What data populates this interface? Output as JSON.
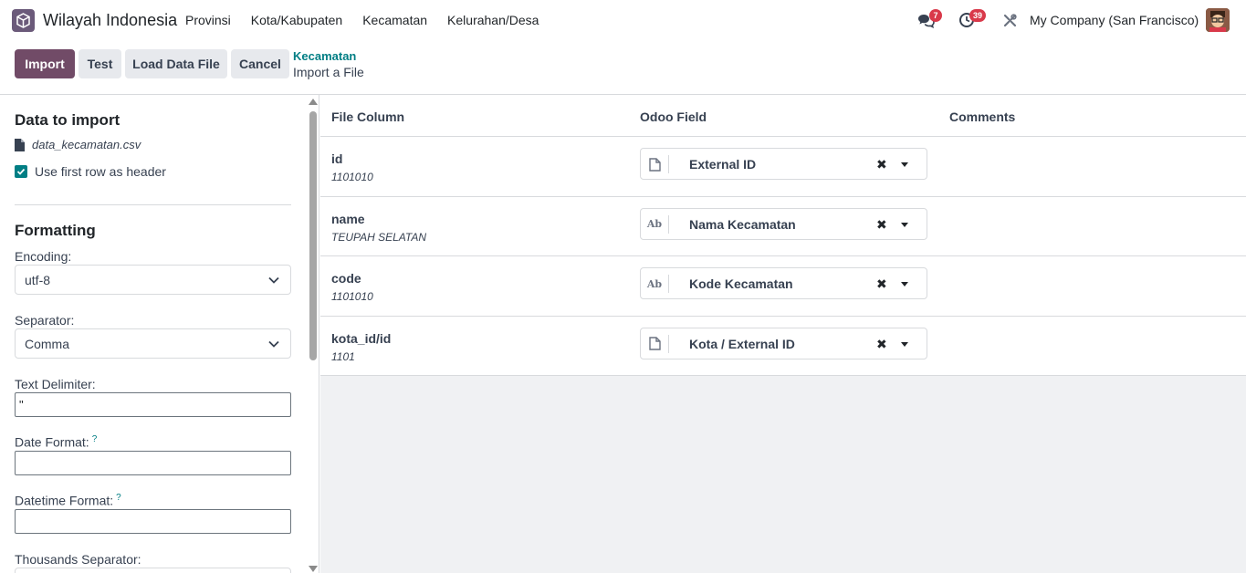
{
  "navbar": {
    "app_name": "Wilayah Indonesia",
    "menu": [
      "Provinsi",
      "Kota/Kabupaten",
      "Kecamatan",
      "Kelurahan/Desa"
    ],
    "messages_count": "7",
    "activities_count": "39",
    "company": "My Company (San Francisco)"
  },
  "control": {
    "import_label": "Import",
    "test_label": "Test",
    "load_label": "Load Data File",
    "cancel_label": "Cancel",
    "breadcrumb_parent": "Kecamatan",
    "breadcrumb_current": "Import a File"
  },
  "sidebar": {
    "data_title": "Data to import",
    "file_name": "data_kecamatan.csv",
    "header_checkbox_label": "Use first row as header",
    "formatting_title": "Formatting",
    "encoding_label": "Encoding:",
    "encoding_value": "utf-8",
    "separator_label": "Separator:",
    "separator_value": "Comma",
    "text_delimiter_label": "Text Delimiter:",
    "text_delimiter_value": "\"",
    "date_format_label": "Date Format:",
    "datetime_format_label": "Datetime Format:",
    "thousands_label": "Thousands Separator:",
    "help_mark": "?"
  },
  "mapping": {
    "headers": {
      "file_column": "File Column",
      "odoo_field": "Odoo Field",
      "comments": "Comments"
    },
    "rows": [
      {
        "column": "id",
        "sample": "1101010",
        "field": "External ID",
        "field_icon": "file-icon"
      },
      {
        "column": "name",
        "sample": "TEUPAH SELATAN",
        "field": "Nama Kecamatan",
        "field_icon": "text-ab-icon"
      },
      {
        "column": "code",
        "sample": "1101010",
        "field": "Kode Kecamatan",
        "field_icon": "text-ab-icon"
      },
      {
        "column": "kota_id/id",
        "sample": "1101",
        "field": "Kota / External ID",
        "field_icon": "file-icon"
      }
    ],
    "clear_symbol": "✖",
    "ab_text": "Ab"
  },
  "colors": {
    "primary": "#714b67",
    "accent": "#017e84",
    "badge": "#d9394a"
  }
}
